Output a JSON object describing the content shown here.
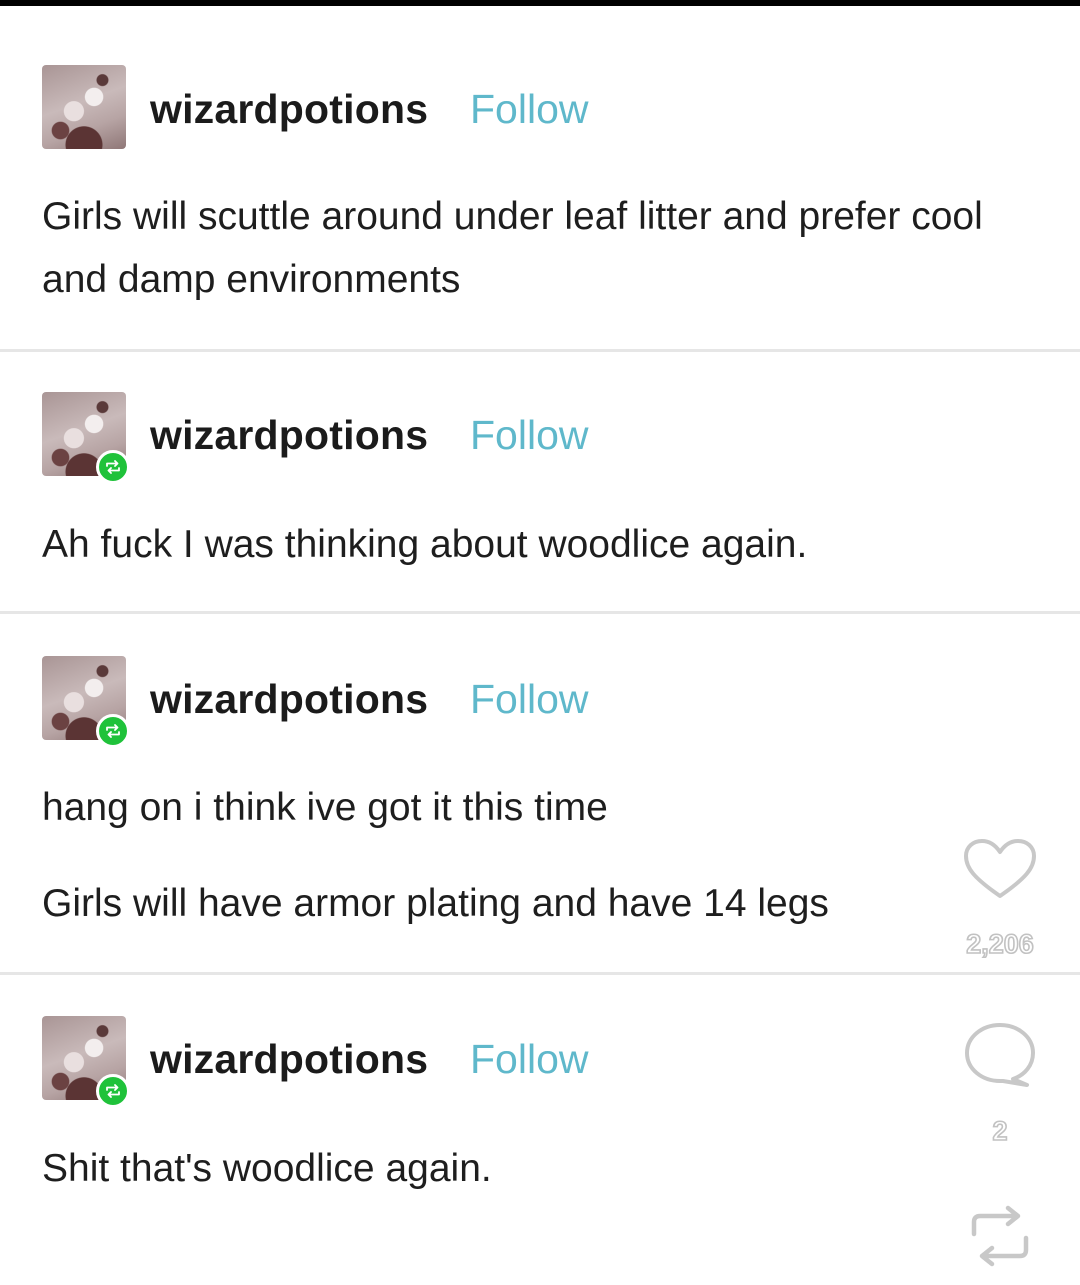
{
  "posts": [
    {
      "username": "wizardpotions",
      "follow_label": "Follow",
      "is_reblog": false,
      "paragraphs": [
        "Girls will scuttle around under leaf litter and prefer cool and damp environments"
      ]
    },
    {
      "username": "wizardpotions",
      "follow_label": "Follow",
      "is_reblog": true,
      "paragraphs": [
        "Ah fuck I was thinking about woodlice again."
      ]
    },
    {
      "username": "wizardpotions",
      "follow_label": "Follow",
      "is_reblog": true,
      "paragraphs": [
        "hang on i think ive got it this time",
        "Girls will have armor plating and have 14 legs"
      ]
    },
    {
      "username": "wizardpotions",
      "follow_label": "Follow",
      "is_reblog": true,
      "paragraphs": [
        "Shit that's woodlice again."
      ]
    }
  ],
  "actions": {
    "like": {
      "icon": "heart-icon",
      "count": "2,206"
    },
    "comment": {
      "icon": "comment-bubble-icon",
      "count": "2"
    },
    "reblog": {
      "icon": "reblog-icon"
    }
  },
  "colors": {
    "follow": "#5fb8cb",
    "reblog_badge": "#1fc23a",
    "divider": "#e6e6e6",
    "text": "#1e1e1e"
  }
}
